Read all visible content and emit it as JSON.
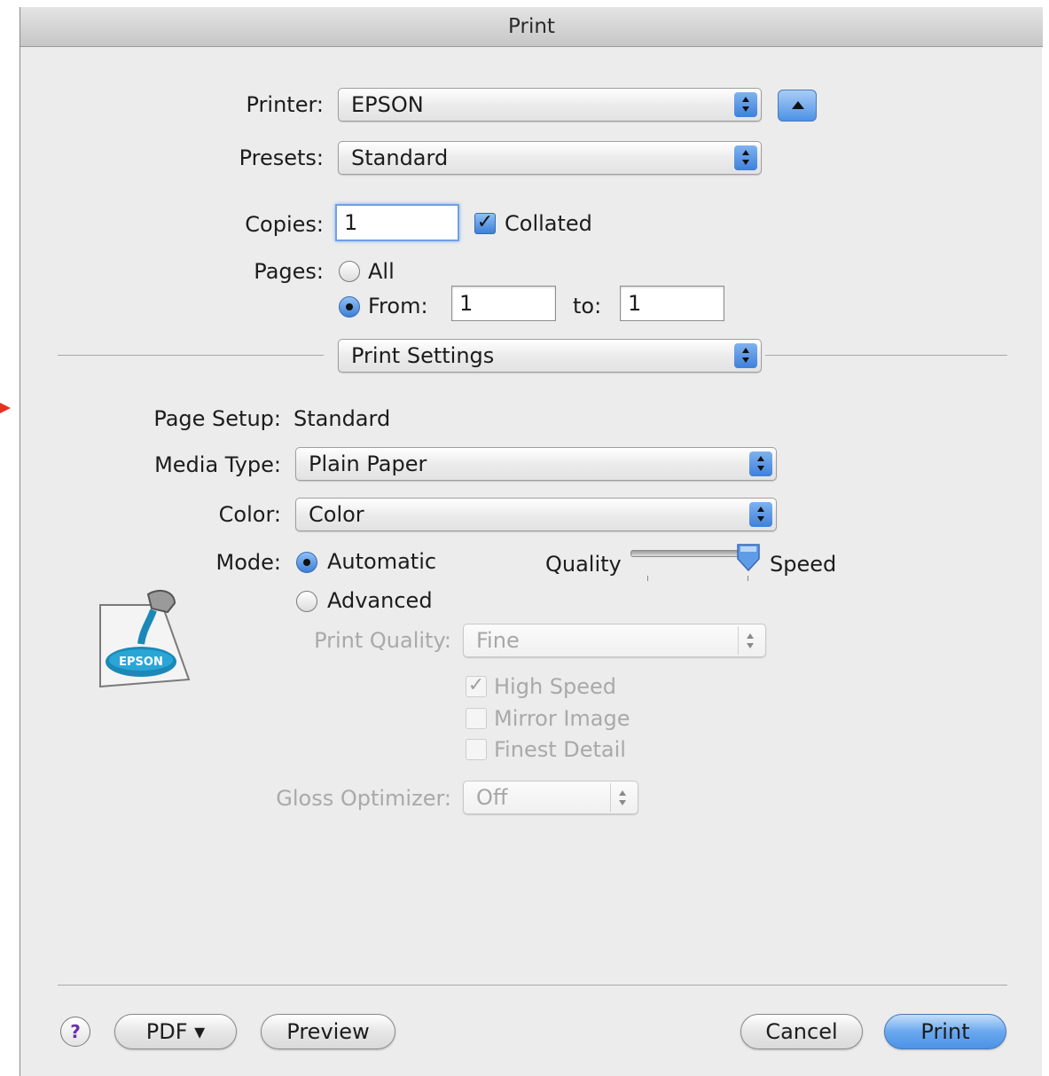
{
  "window": {
    "title": "Print"
  },
  "printer": {
    "label": "Printer:",
    "value": "EPSON"
  },
  "presets": {
    "label": "Presets:",
    "value": "Standard"
  },
  "copies": {
    "label": "Copies:",
    "value": "1",
    "collated_label": "Collated",
    "collated_checked": true
  },
  "pages": {
    "label": "Pages:",
    "all_label": "All",
    "from_label": "From:",
    "from_value": "1",
    "to_label": "to:",
    "to_value": "1",
    "selected": "from"
  },
  "panel_selector": {
    "value": "Print Settings"
  },
  "settings": {
    "page_setup_label": "Page Setup:",
    "page_setup_value": "Standard",
    "media_type_label": "Media Type:",
    "media_type_value": "Plain Paper",
    "color_label": "Color:",
    "color_value": "Color",
    "mode_label": "Mode:",
    "mode_automatic": "Automatic",
    "mode_advanced": "Advanced",
    "mode_selected": "Automatic",
    "quality_label": "Quality",
    "speed_label": "Speed",
    "slider_level": 1.0,
    "print_quality_label": "Print Quality:",
    "print_quality_value": "Fine",
    "high_speed_label": "High Speed",
    "high_speed_checked": true,
    "mirror_image_label": "Mirror Image",
    "finest_detail_label": "Finest Detail",
    "gloss_label": "Gloss Optimizer:",
    "gloss_value": "Off",
    "logo_text": "EPSON"
  },
  "footer": {
    "help": "?",
    "pdf": "PDF ▾",
    "preview": "Preview",
    "cancel": "Cancel",
    "print": "Print"
  },
  "colors": {
    "accent": "#4d92e6",
    "window_bg": "#ececec",
    "annotation_arrow": "#e8321e"
  }
}
